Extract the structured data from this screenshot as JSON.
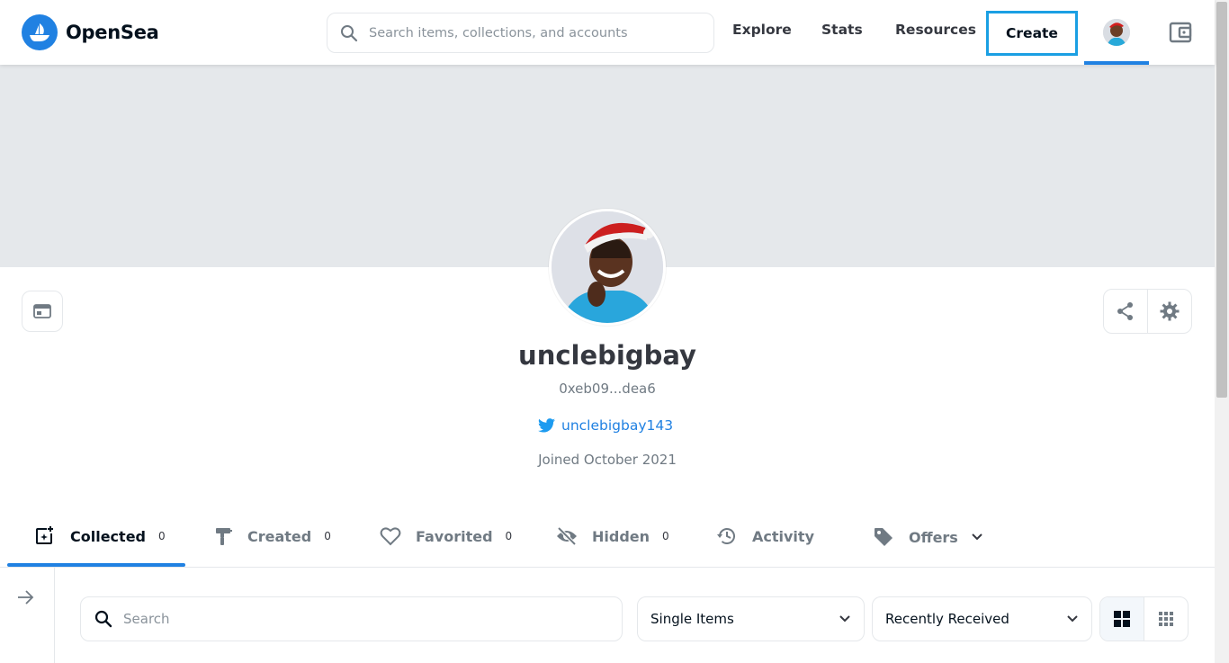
{
  "header": {
    "logo_text": "OpenSea",
    "search_placeholder": "Search items, collections, and accounts",
    "nav": [
      "Explore",
      "Stats",
      "Resources"
    ],
    "create_label": "Create"
  },
  "profile": {
    "username": "unclebigbay",
    "address": "0xeb09...dea6",
    "twitter_handle": "unclebigbay143",
    "joined": "Joined October 2021"
  },
  "tabs": [
    {
      "label": "Collected",
      "count": "0",
      "icon": "collected-icon"
    },
    {
      "label": "Created",
      "count": "0",
      "icon": "paintbrush-icon"
    },
    {
      "label": "Favorited",
      "count": "0",
      "icon": "heart-icon"
    },
    {
      "label": "Hidden",
      "count": "0",
      "icon": "eye-off-icon"
    },
    {
      "label": "Activity",
      "count": "",
      "icon": "history-icon"
    },
    {
      "label": "Offers",
      "count": "",
      "icon": "tag-icon"
    }
  ],
  "filters": {
    "search_placeholder": "Search",
    "item_type": "Single Items",
    "sort": "Recently Received"
  },
  "colors": {
    "accent": "#2081e2",
    "highlight_border": "#1a9fe3",
    "banner": "#e5e8eb"
  }
}
